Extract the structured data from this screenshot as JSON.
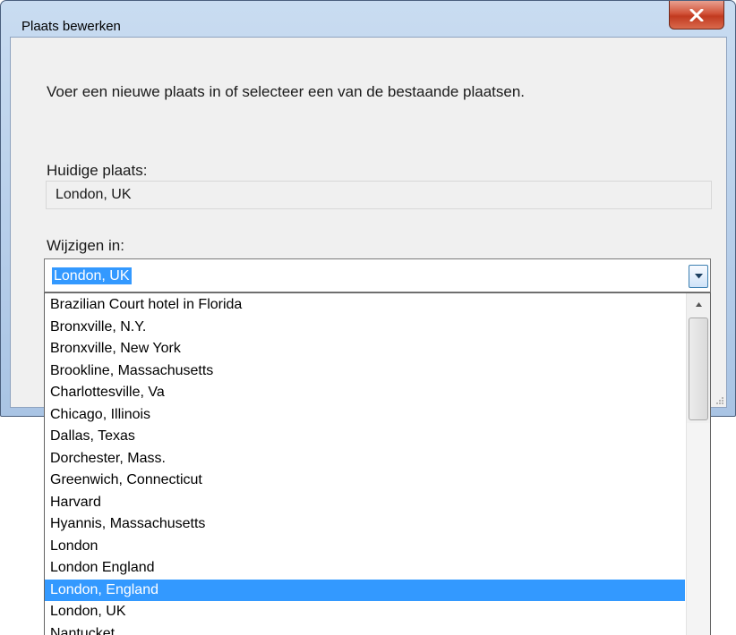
{
  "window": {
    "title": "Plaats bewerken"
  },
  "dialog": {
    "instruction": "Voer een nieuwe plaats in of selecteer een van de bestaande plaatsen.",
    "current_label": "Huidige plaats:",
    "current_value": "London, UK",
    "change_label": "Wijzigen in:"
  },
  "combo": {
    "value": "London, UK"
  },
  "dropdown": {
    "items": [
      "Brazilian Court hotel in Florida",
      "Bronxville, N.Y.",
      "Bronxville, New York",
      "Brookline, Massachusetts",
      "Charlottesville, Va",
      "Chicago, Illinois",
      "Dallas, Texas",
      "Dorchester, Mass.",
      "Greenwich, Connecticut",
      "Harvard",
      "Hyannis, Massachusetts",
      "London",
      "London England",
      "London, England",
      "London, UK",
      "Nantucket"
    ],
    "selected": "London, England"
  },
  "colors": {
    "selection": "#3399ff",
    "close_button": "#c13a20"
  },
  "icons": {
    "close": "close-icon",
    "dropdown": "chevron-down-icon",
    "scroll_up": "chevron-up-icon"
  }
}
